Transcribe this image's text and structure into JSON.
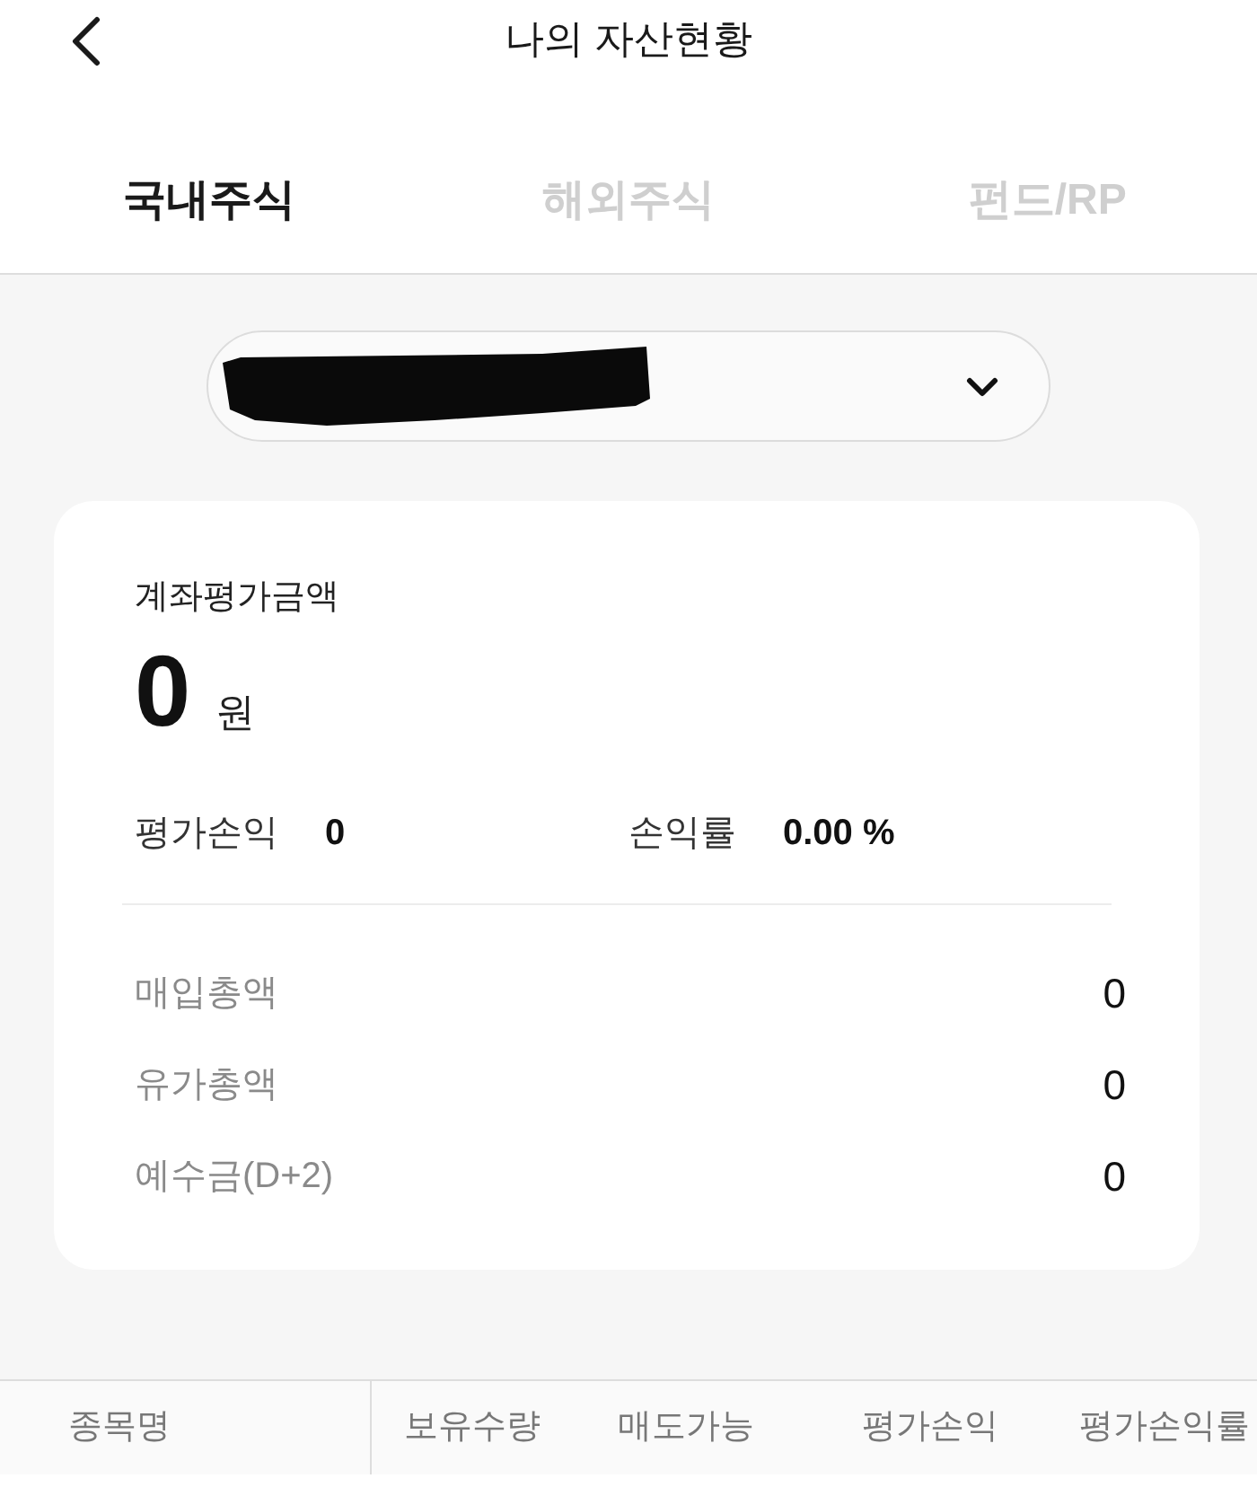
{
  "header": {
    "title": "나의 자산현황"
  },
  "tabs": [
    {
      "label": "국내주식",
      "selected": true
    },
    {
      "label": "해외주식",
      "selected": false
    },
    {
      "label": "펀드/RP",
      "selected": false
    }
  ],
  "account_selector": {
    "redacted": true
  },
  "summary": {
    "label": "계좌평가금액",
    "amount": "0",
    "unit": "원",
    "stats": [
      {
        "label": "평가손익",
        "value": "0"
      },
      {
        "label": "손익률",
        "value": "0.00 %"
      }
    ],
    "rows": [
      {
        "label": "매입총액",
        "value": "0"
      },
      {
        "label": "유가총액",
        "value": "0"
      },
      {
        "label": "예수금(D+2)",
        "value": "0"
      }
    ]
  },
  "table": {
    "columns": [
      "종목명",
      "보유수량",
      "매도가능",
      "평가손익",
      "평가손익률"
    ]
  }
}
